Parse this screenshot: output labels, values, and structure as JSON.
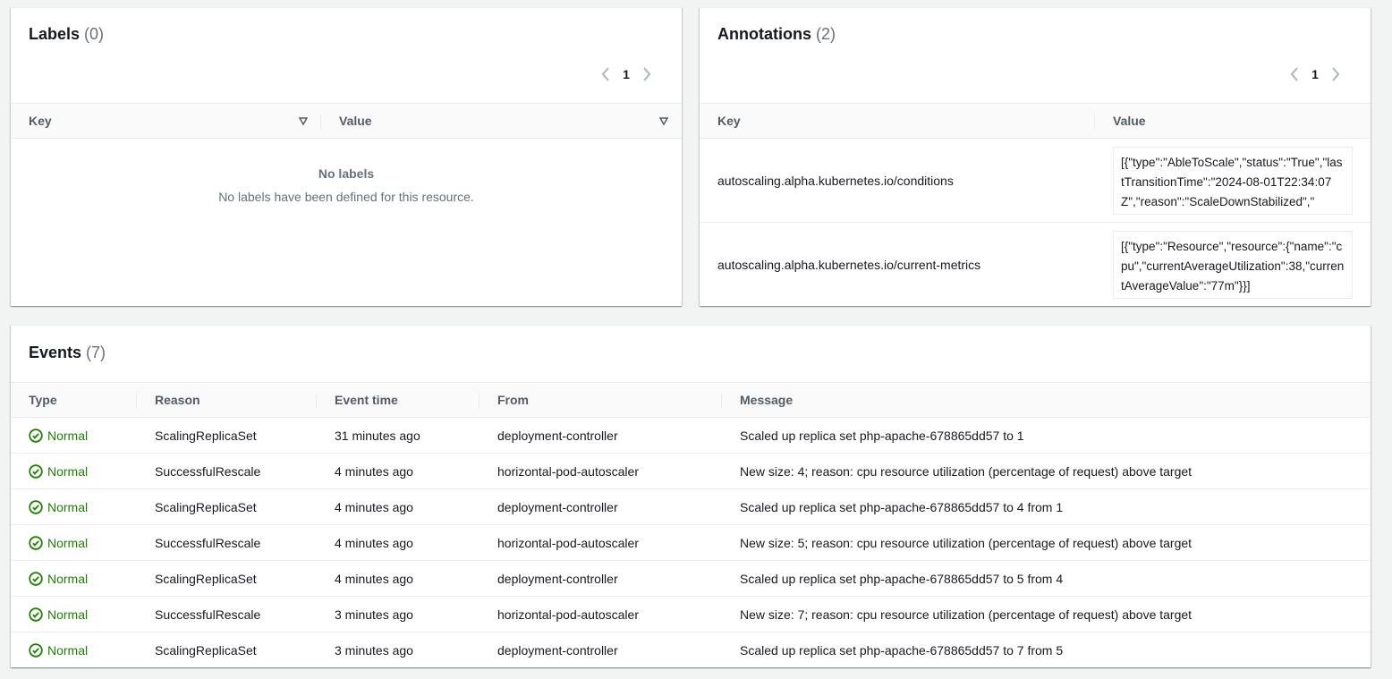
{
  "labels": {
    "title": "Labels",
    "count": "(0)",
    "page": "1",
    "columns": {
      "key": "Key",
      "value": "Value"
    },
    "empty_title": "No labels",
    "empty_desc": "No labels have been defined for this resource."
  },
  "annotations": {
    "title": "Annotations",
    "count": "(2)",
    "page": "1",
    "columns": {
      "key": "Key",
      "value": "Value"
    },
    "rows": [
      {
        "key": "autoscaling.alpha.kubernetes.io/conditions",
        "value": "[{\"type\":\"AbleToScale\",\"status\":\"True\",\"lastTransitionTime\":\"2024-08-01T22:34:07Z\",\"reason\":\"ScaleDownStabilized\",\""
      },
      {
        "key": "autoscaling.alpha.kubernetes.io/current-metrics",
        "value": "[{\"type\":\"Resource\",\"resource\":{\"name\":\"cpu\",\"currentAverageUtilization\":38,\"currentAverageValue\":\"77m\"}}]"
      }
    ]
  },
  "events": {
    "title": "Events",
    "count": "(7)",
    "columns": {
      "type": "Type",
      "reason": "Reason",
      "time": "Event time",
      "from": "From",
      "message": "Message"
    },
    "rows": [
      {
        "type": "Normal",
        "reason": "ScalingReplicaSet",
        "time": "31 minutes ago",
        "from": "deployment-controller",
        "message": "Scaled up replica set php-apache-678865dd57 to 1"
      },
      {
        "type": "Normal",
        "reason": "SuccessfulRescale",
        "time": "4 minutes ago",
        "from": "horizontal-pod-autoscaler",
        "message": "New size: 4; reason: cpu resource utilization (percentage of request) above target"
      },
      {
        "type": "Normal",
        "reason": "ScalingReplicaSet",
        "time": "4 minutes ago",
        "from": "deployment-controller",
        "message": "Scaled up replica set php-apache-678865dd57 to 4 from 1"
      },
      {
        "type": "Normal",
        "reason": "SuccessfulRescale",
        "time": "4 minutes ago",
        "from": "horizontal-pod-autoscaler",
        "message": "New size: 5; reason: cpu resource utilization (percentage of request) above target"
      },
      {
        "type": "Normal",
        "reason": "ScalingReplicaSet",
        "time": "4 minutes ago",
        "from": "deployment-controller",
        "message": "Scaled up replica set php-apache-678865dd57 to 5 from 4"
      },
      {
        "type": "Normal",
        "reason": "SuccessfulRescale",
        "time": "3 minutes ago",
        "from": "horizontal-pod-autoscaler",
        "message": "New size: 7; reason: cpu resource utilization (percentage of request) above target"
      },
      {
        "type": "Normal",
        "reason": "ScalingReplicaSet",
        "time": "3 minutes ago",
        "from": "deployment-controller",
        "message": "Scaled up replica set php-apache-678865dd57 to 7 from 5"
      }
    ]
  },
  "icons": {
    "status_ok": "check-circle-icon",
    "prev": "chevron-left-icon",
    "next": "chevron-right-icon",
    "sort": "caret-down-outline-icon"
  },
  "colors": {
    "success": "#1d8102",
    "muted": "#687078",
    "border": "#eaeded"
  }
}
